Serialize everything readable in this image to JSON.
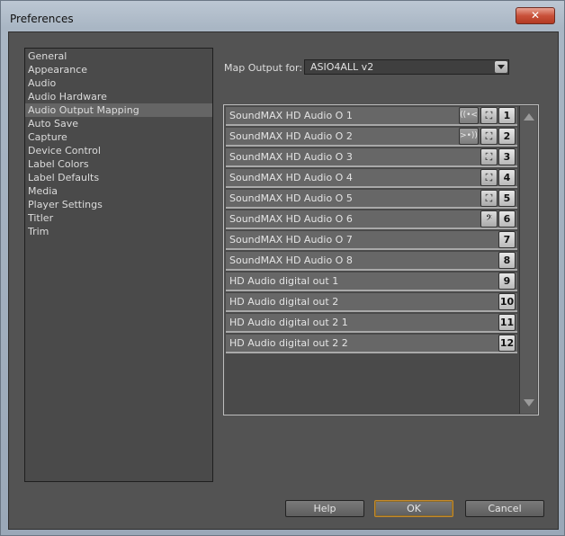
{
  "window": {
    "title": "Preferences",
    "close_label": "✕"
  },
  "categories": [
    {
      "label": "General"
    },
    {
      "label": "Appearance"
    },
    {
      "label": "Audio"
    },
    {
      "label": "Audio Hardware"
    },
    {
      "label": "Audio Output Mapping",
      "selected": true
    },
    {
      "label": "Auto Save"
    },
    {
      "label": "Capture"
    },
    {
      "label": "Device Control"
    },
    {
      "label": "Label Colors"
    },
    {
      "label": "Label Defaults"
    },
    {
      "label": "Media"
    },
    {
      "label": "Player Settings"
    },
    {
      "label": "Titler"
    },
    {
      "label": "Trim"
    }
  ],
  "map_output": {
    "label": "Map Output for:",
    "value": "ASIO4ALL v2"
  },
  "channels": [
    {
      "label": "SoundMAX HD Audio O 1",
      "number": "1",
      "icons": [
        "stereo-left-icon",
        "speaker-icon"
      ]
    },
    {
      "label": "SoundMAX HD Audio O 2",
      "number": "2",
      "icons": [
        "stereo-right-icon",
        "speaker-icon"
      ]
    },
    {
      "label": "SoundMAX HD Audio O 3",
      "number": "3",
      "icons": [
        "speaker-icon"
      ]
    },
    {
      "label": "SoundMAX HD Audio O 4",
      "number": "4",
      "icons": [
        "speaker-icon"
      ]
    },
    {
      "label": "SoundMAX HD Audio O 5",
      "number": "5",
      "icons": [
        "center-speaker-icon"
      ]
    },
    {
      "label": "SoundMAX HD Audio O 6",
      "number": "6",
      "icons": [
        "bass-clef-icon"
      ]
    },
    {
      "label": "SoundMAX HD Audio O 7",
      "number": "7",
      "icons": []
    },
    {
      "label": "SoundMAX HD Audio O 8",
      "number": "8",
      "icons": []
    },
    {
      "label": "HD Audio digital out 1",
      "number": "9",
      "icons": []
    },
    {
      "label": "HD Audio digital out 2",
      "number": "10",
      "icons": []
    },
    {
      "label": "HD Audio digital out 2 1",
      "number": "11",
      "icons": []
    },
    {
      "label": "HD Audio digital out 2 2",
      "number": "12",
      "icons": []
    }
  ],
  "buttons": {
    "help": "Help",
    "ok": "OK",
    "cancel": "Cancel"
  }
}
